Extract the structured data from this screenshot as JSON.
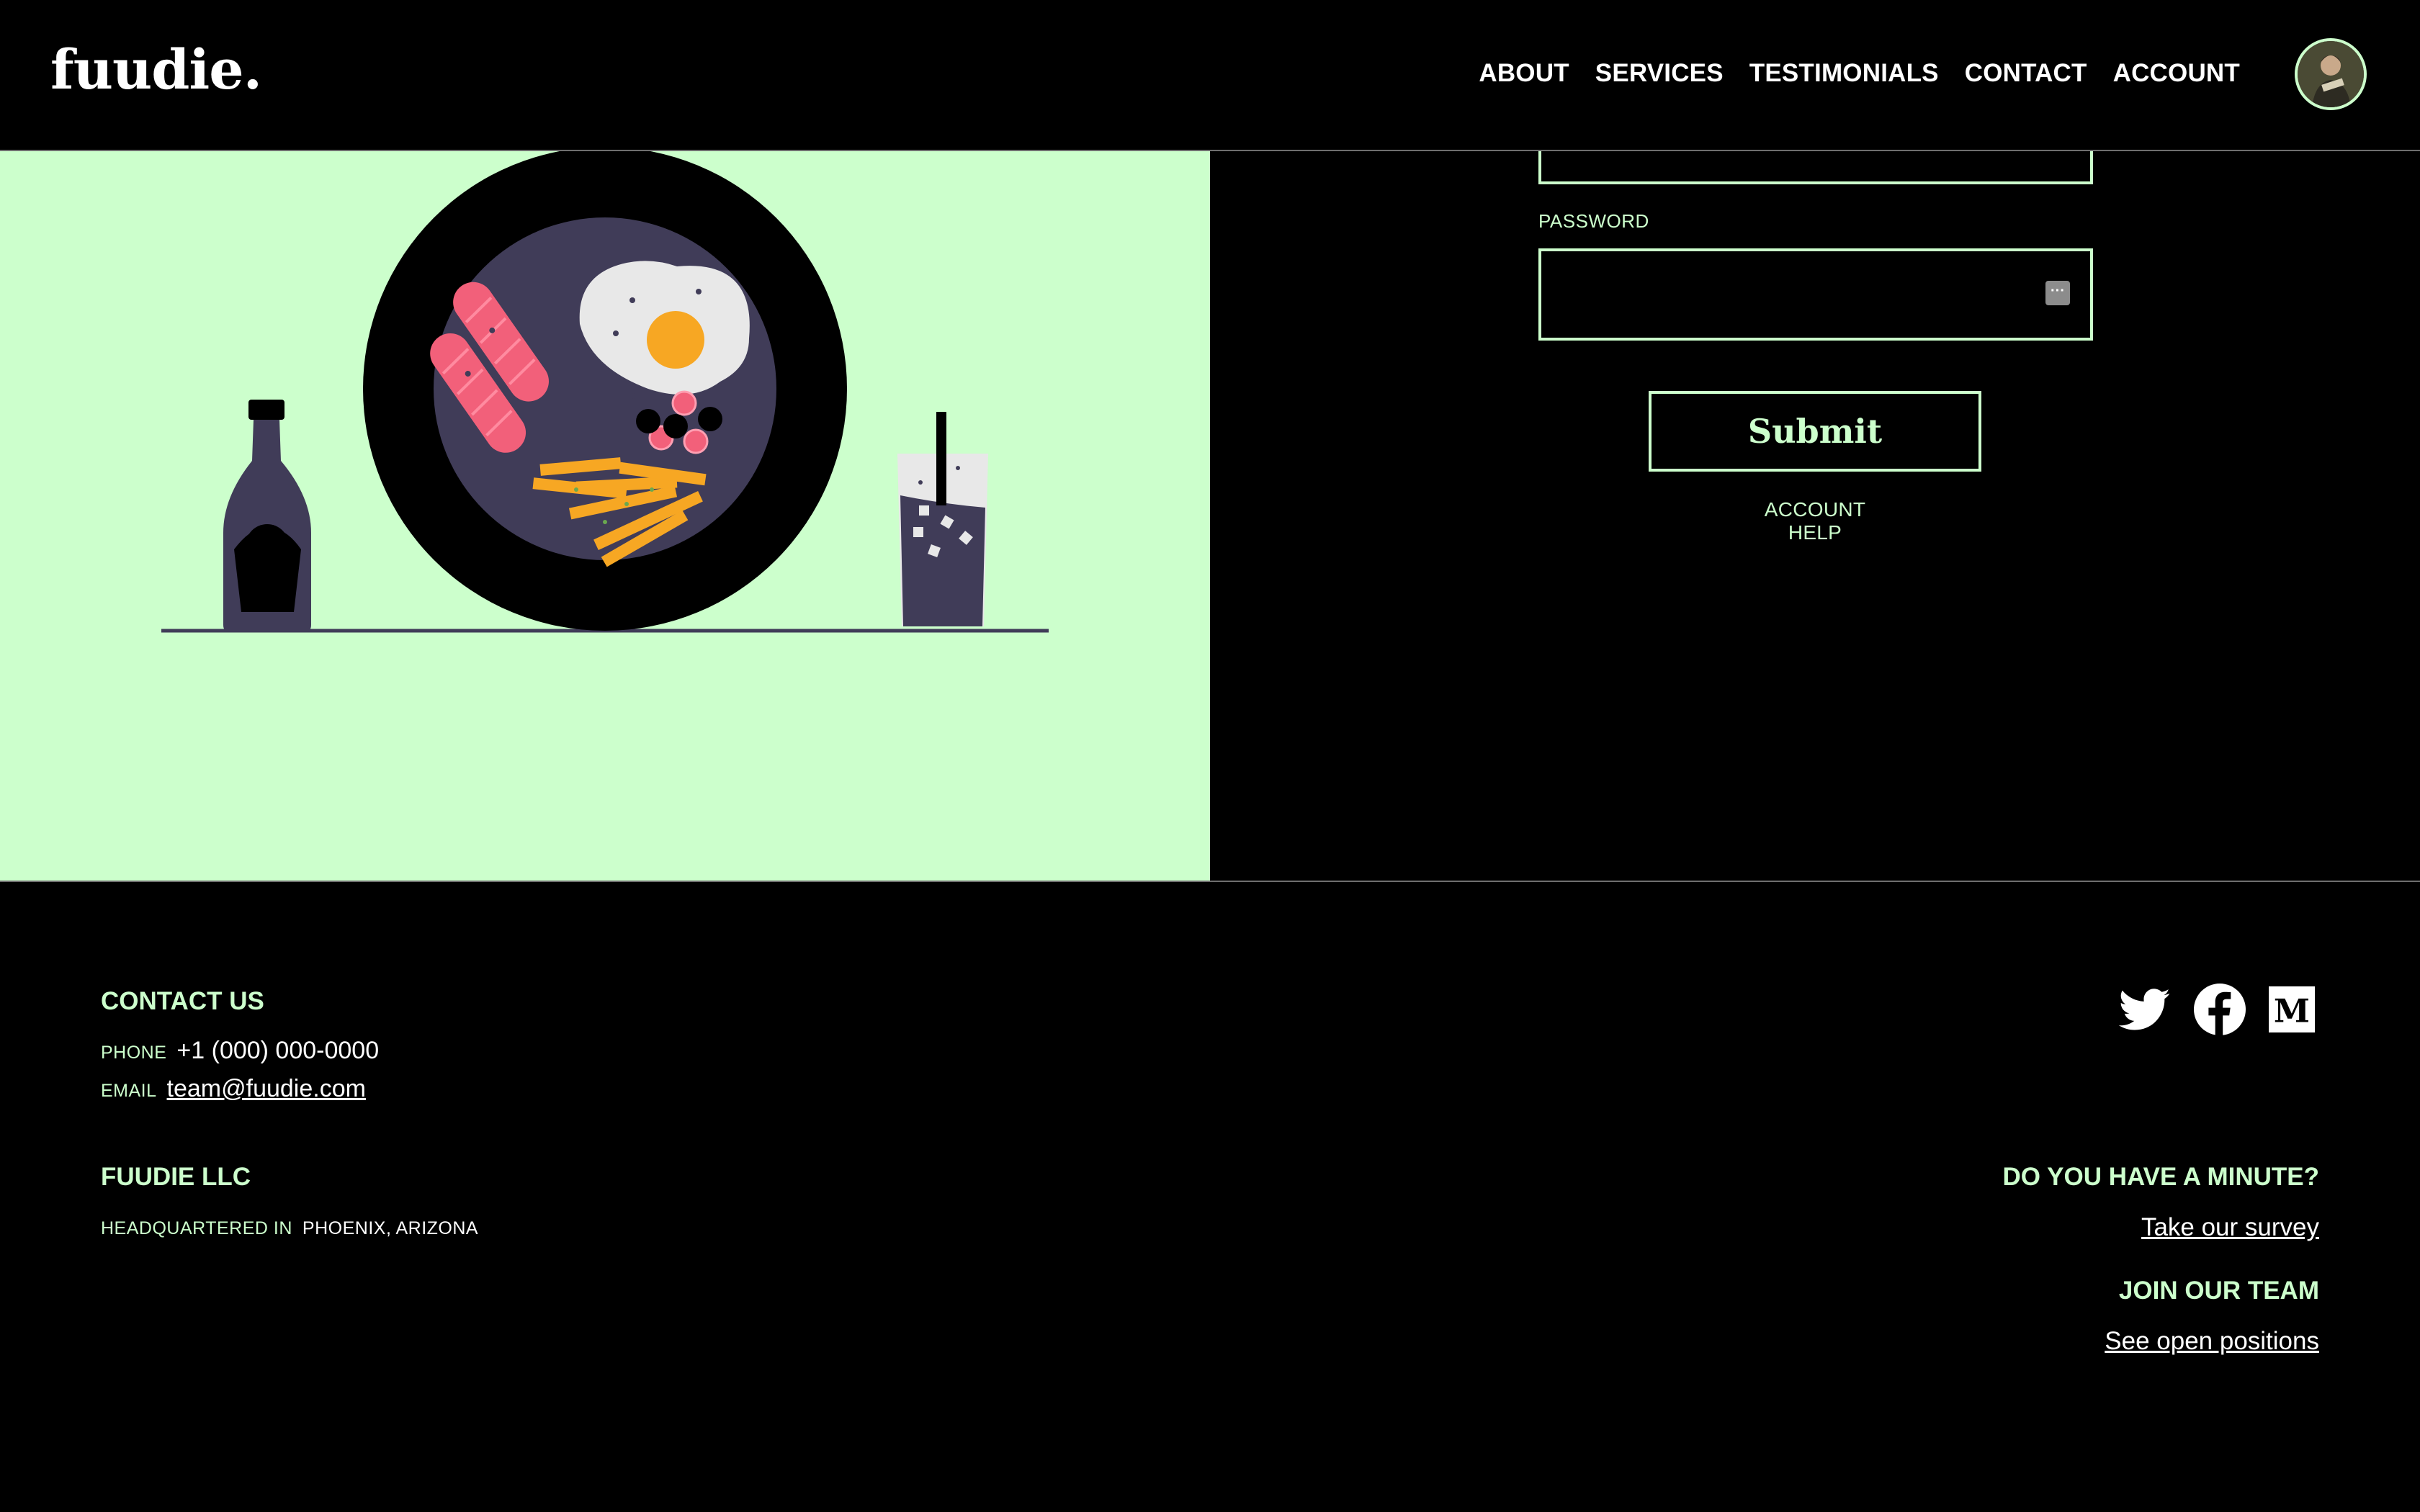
{
  "brand": {
    "logo": "fuudie."
  },
  "nav": {
    "items": [
      {
        "label": "ABOUT",
        "name": "nav-about"
      },
      {
        "label": "SERVICES",
        "name": "nav-services"
      },
      {
        "label": "TESTIMONIALS",
        "name": "nav-testimonials"
      },
      {
        "label": "CONTACT",
        "name": "nav-contact"
      },
      {
        "label": "ACCOUNT",
        "name": "nav-account"
      }
    ]
  },
  "form": {
    "password_label": "PASSWORD",
    "password_value": "",
    "submit_label": "Submit",
    "account_help": "ACCOUNT HELP"
  },
  "footer": {
    "contact_heading": "CONTACT US",
    "phone_label": "PHONE",
    "phone_value": "+1 (000) 000-0000",
    "email_label": "EMAIL",
    "email_value": "team@fuudie.com",
    "company_heading": "FUUDIE LLC",
    "hq_label": "HEADQUARTERED IN",
    "hq_value": "PHOENIX, ARIZONA",
    "survey_heading": "DO YOU HAVE A MINUTE?",
    "survey_link": "Take our survey",
    "team_heading": "JOIN OUR TEAM",
    "team_link": "See open positions",
    "social": [
      "twitter-icon",
      "facebook-icon",
      "medium-icon"
    ]
  },
  "colors": {
    "accent": "#ccffcc",
    "background": "#000000",
    "plate_inner": "#403c58",
    "sausage": "#f2607a",
    "yolk": "#f7a723",
    "fries": "#f7a723"
  }
}
